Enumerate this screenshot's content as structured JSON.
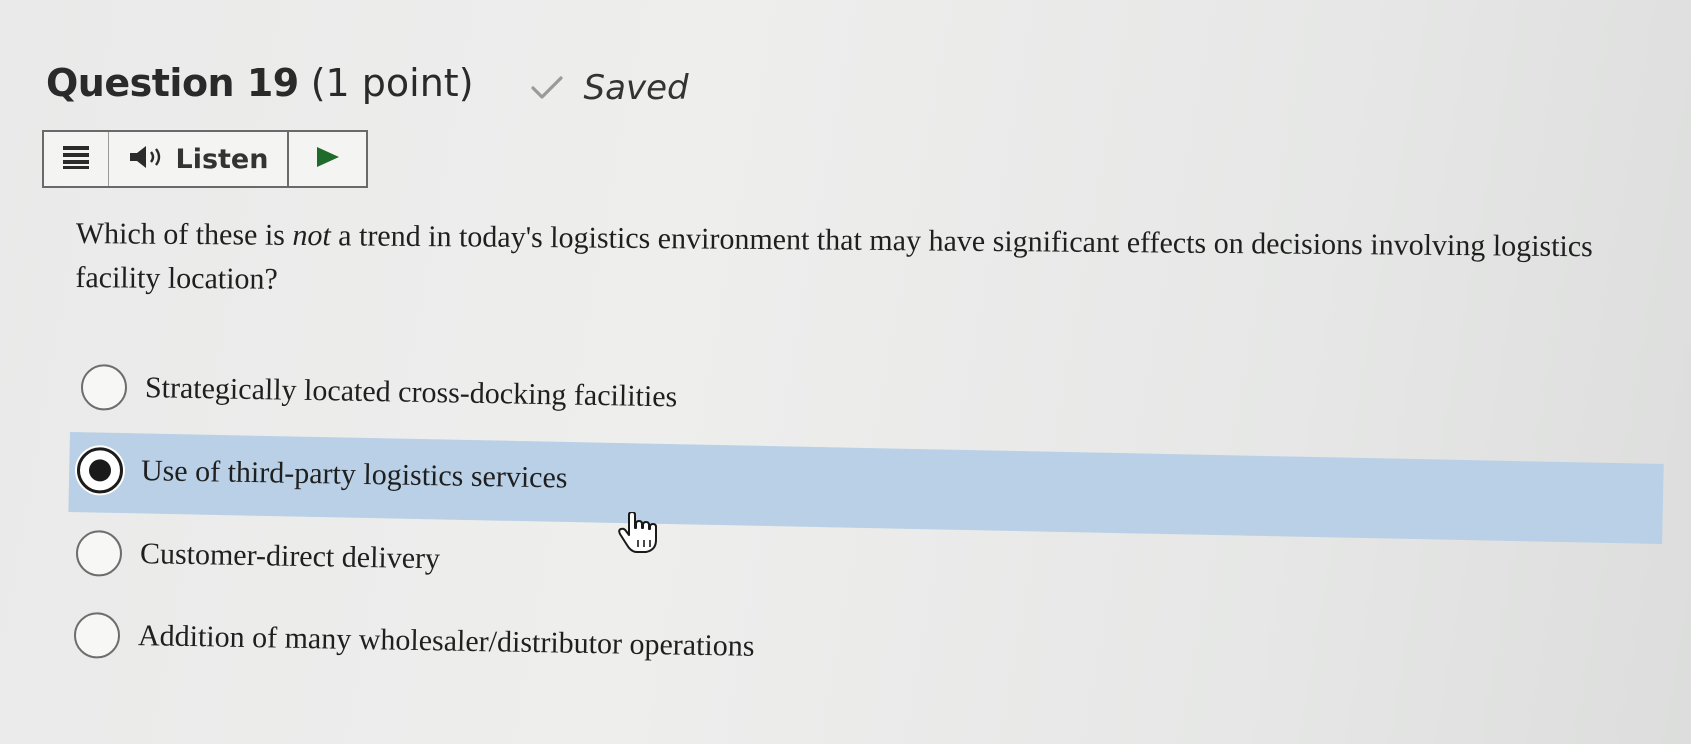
{
  "header": {
    "title": "Question 19",
    "points": "(1 point)",
    "status": "Saved"
  },
  "toolbar": {
    "listen_label": "Listen"
  },
  "question": {
    "text_before": "Which of these is ",
    "emphasis": "not",
    "text_after": " a trend in today's logistics environment that may have significant effects on decisions involving logistics facility location?"
  },
  "options": [
    {
      "label": "Strategically located cross-docking facilities",
      "selected": false
    },
    {
      "label": "Use of third-party logistics services",
      "selected": true
    },
    {
      "label": "Customer-direct delivery",
      "selected": false
    },
    {
      "label": "Addition of many wholesaler/distributor operations",
      "selected": false
    }
  ],
  "colors": {
    "selected_highlight": "#b9d0e6",
    "saved_check": "#9a9a9a"
  }
}
